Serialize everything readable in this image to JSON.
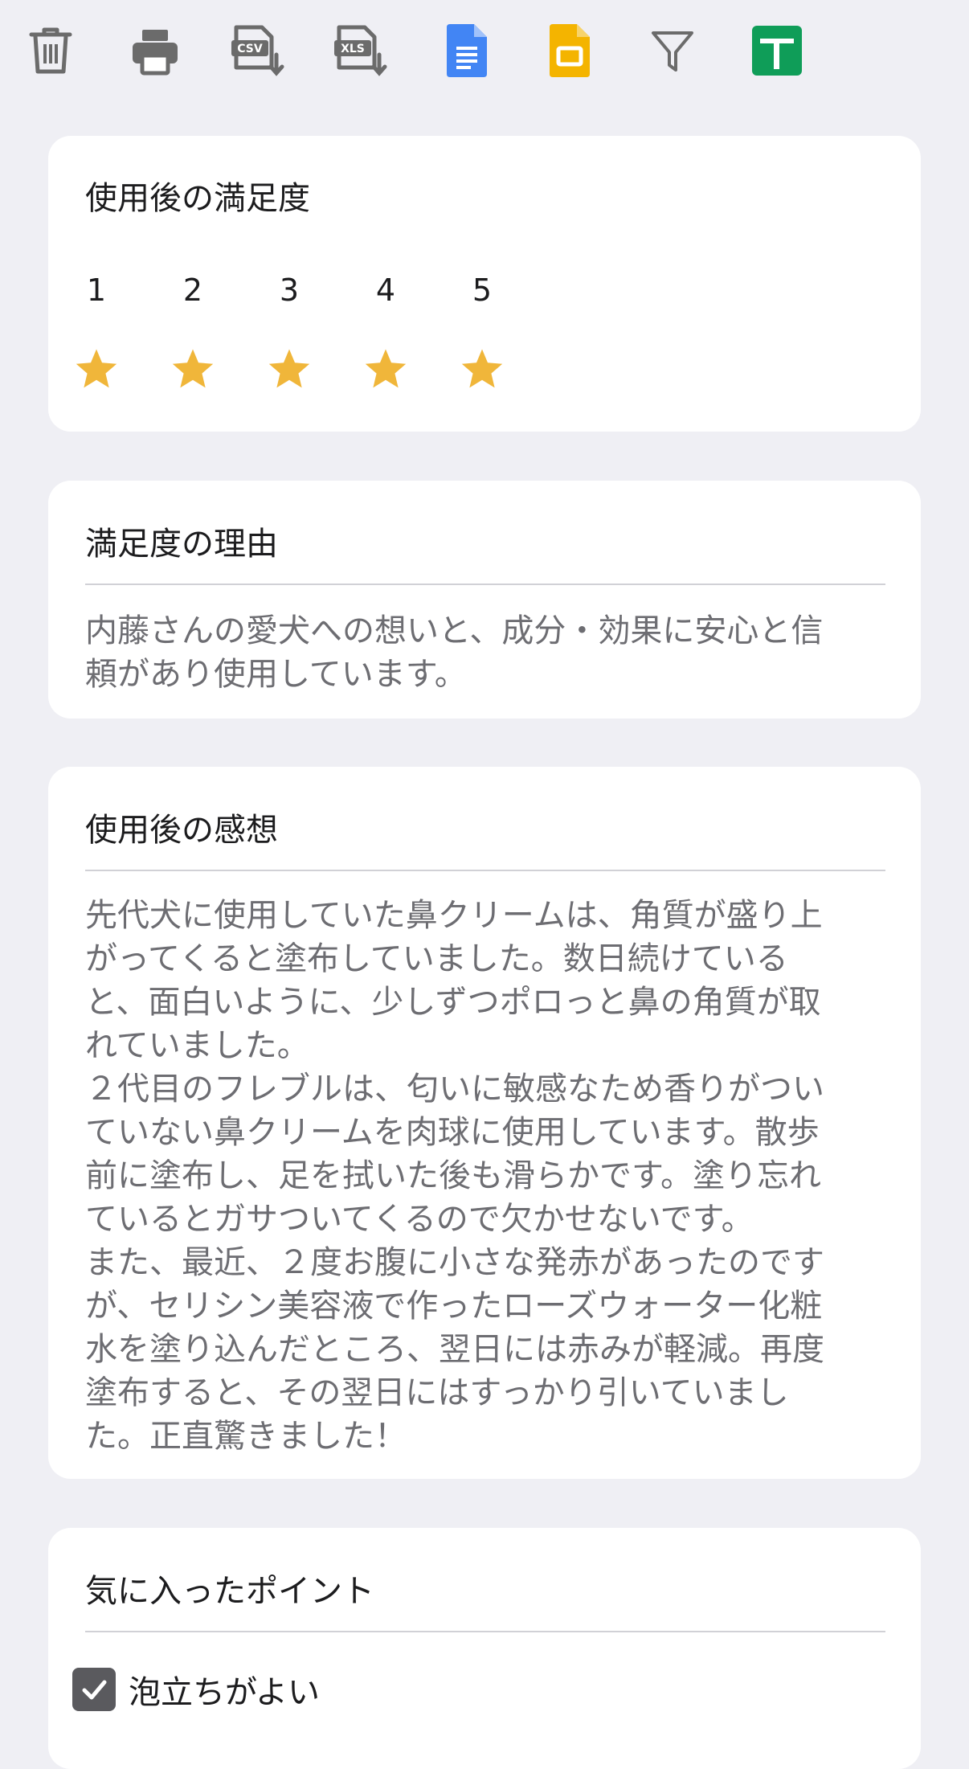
{
  "toolbar": {
    "items": [
      {
        "icon": "trash-icon",
        "label": ""
      },
      {
        "icon": "print-icon",
        "label": ""
      },
      {
        "icon": "csv-download-icon",
        "label": "CSV"
      },
      {
        "icon": "xls-download-icon",
        "label": "XLS"
      },
      {
        "icon": "google-docs-icon",
        "label": ""
      },
      {
        "icon": "google-slides-icon",
        "label": ""
      },
      {
        "icon": "filter-icon",
        "label": ""
      },
      {
        "icon": "google-sheets-icon",
        "label": ""
      }
    ],
    "colors": {
      "gray": "#6b6b6b",
      "docs": "#4285f4",
      "slides": "#f4b400",
      "sheets": "#0f9d58"
    }
  },
  "satisfaction": {
    "title": "使用後の満足度",
    "scale": [
      "1",
      "2",
      "3",
      "4",
      "5"
    ],
    "rating": 5,
    "star_color": "#f0b63a"
  },
  "reason": {
    "title": "満足度の理由",
    "text": "内藤さんの愛犬への想いと、成分・効果に安心と信\n頼があり使用しています。"
  },
  "impressions": {
    "title": "使用後の感想",
    "text": "先代犬に使用していた鼻クリームは、角質が盛り上\nがってくると塗布していました。数日続けている\nと、面白いように、少しずつポロっと鼻の角質が取\nれていました。\n２代目のフレブルは、匂いに敏感なため香りがつい\nていない鼻クリームを肉球に使用しています。散歩\n前に塗布し、足を拭いた後も滑らかです。塗り忘れ\nているとガサついてくるので欠かせないです。\nまた、最近、２度お腹に小さな発赤があったのです\nが、セリシン美容液で作ったローズウォーター化粧\n水を塗り込んだところ、翌日には赤みが軽減。再度\n塗布すると、その翌日にはすっかり引いていまし\nた。正直驚きました！"
  },
  "favorites": {
    "title": "気に入ったポイント",
    "options": [
      {
        "label": "泡立ちがよい",
        "checked": true
      }
    ]
  }
}
